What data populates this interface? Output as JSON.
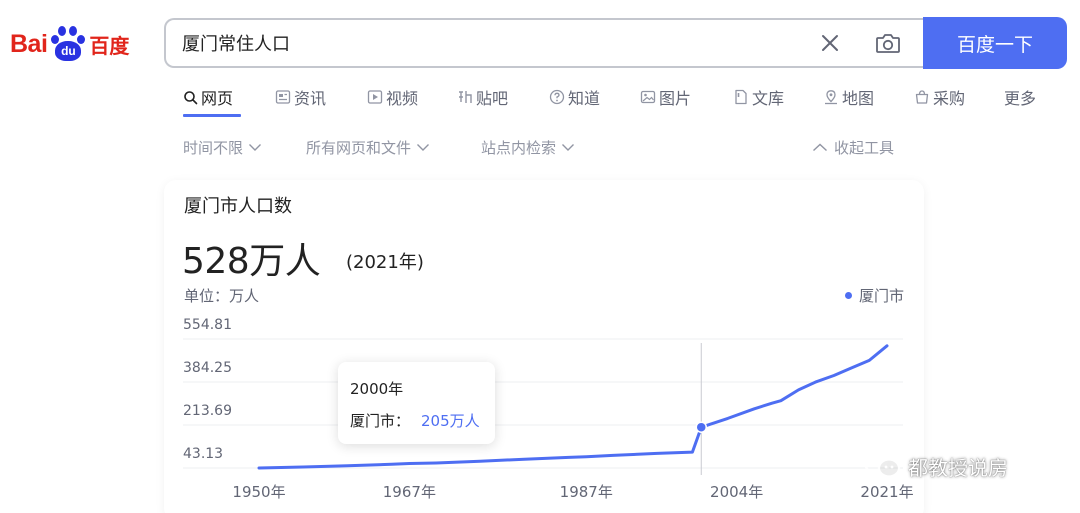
{
  "logo": {
    "latin": "Bai",
    "paw_text": "du",
    "chinese": "百度"
  },
  "search": {
    "query": "厦门常住人口",
    "button_label": "百度一下"
  },
  "tabs": [
    {
      "label": "网页",
      "icon": "search-icon",
      "active": true
    },
    {
      "label": "资讯",
      "icon": "news-icon"
    },
    {
      "label": "视频",
      "icon": "video-icon"
    },
    {
      "label": "贴吧",
      "icon": "tieba-icon"
    },
    {
      "label": "知道",
      "icon": "question-icon"
    },
    {
      "label": "图片",
      "icon": "image-icon"
    },
    {
      "label": "文库",
      "icon": "document-icon"
    },
    {
      "label": "地图",
      "icon": "map-icon"
    },
    {
      "label": "采购",
      "icon": "shopping-icon"
    },
    {
      "label": "更多"
    }
  ],
  "filters": {
    "time": "时间不限",
    "filetype": "所有网页和文件",
    "site": "站点内检索",
    "collapse": "收起工具"
  },
  "card": {
    "title": "厦门市人口数",
    "value": "528万人",
    "year": "(2021年)",
    "unit": "单位：万人",
    "legend": "厦门市"
  },
  "tooltip": {
    "year": "2000年",
    "label": "厦门市：",
    "value": "205万人"
  },
  "watermark": {
    "text": "都教授说房"
  },
  "colors": {
    "accent": "#4e6ef2",
    "logo_red": "#e1251b",
    "logo_blue": "#2932e1"
  },
  "chart_data": {
    "type": "line",
    "series": [
      {
        "name": "厦门市",
        "x": [
          1950,
          1955,
          1960,
          1965,
          1967,
          1970,
          1975,
          1980,
          1985,
          1987,
          1990,
          1995,
          1999,
          2000,
          2003,
          2006,
          2008,
          2009,
          2011,
          2013,
          2015,
          2017,
          2019,
          2021
        ],
        "values": [
          43,
          47,
          52,
          58,
          61,
          63,
          70,
          78,
          85,
          88,
          93,
          101,
          106,
          205,
          240,
          278,
          300,
          310,
          353,
          385,
          410,
          440,
          470,
          528
        ]
      }
    ],
    "xticks": [
      "1950年",
      "1967年",
      "1987年",
      "2004年",
      "2021年"
    ],
    "xtick_values": [
      1950,
      1967,
      1987,
      2004,
      2021
    ],
    "yticks": [
      "43.13",
      "213.69",
      "384.25",
      "554.81"
    ],
    "ytick_values": [
      43.13,
      213.69,
      384.25,
      554.81
    ],
    "xlim": [
      1950,
      2021
    ],
    "ylim": [
      43.13,
      554.81
    ],
    "grid": true,
    "highlight_x": 2000,
    "legend_position": "top-right"
  }
}
